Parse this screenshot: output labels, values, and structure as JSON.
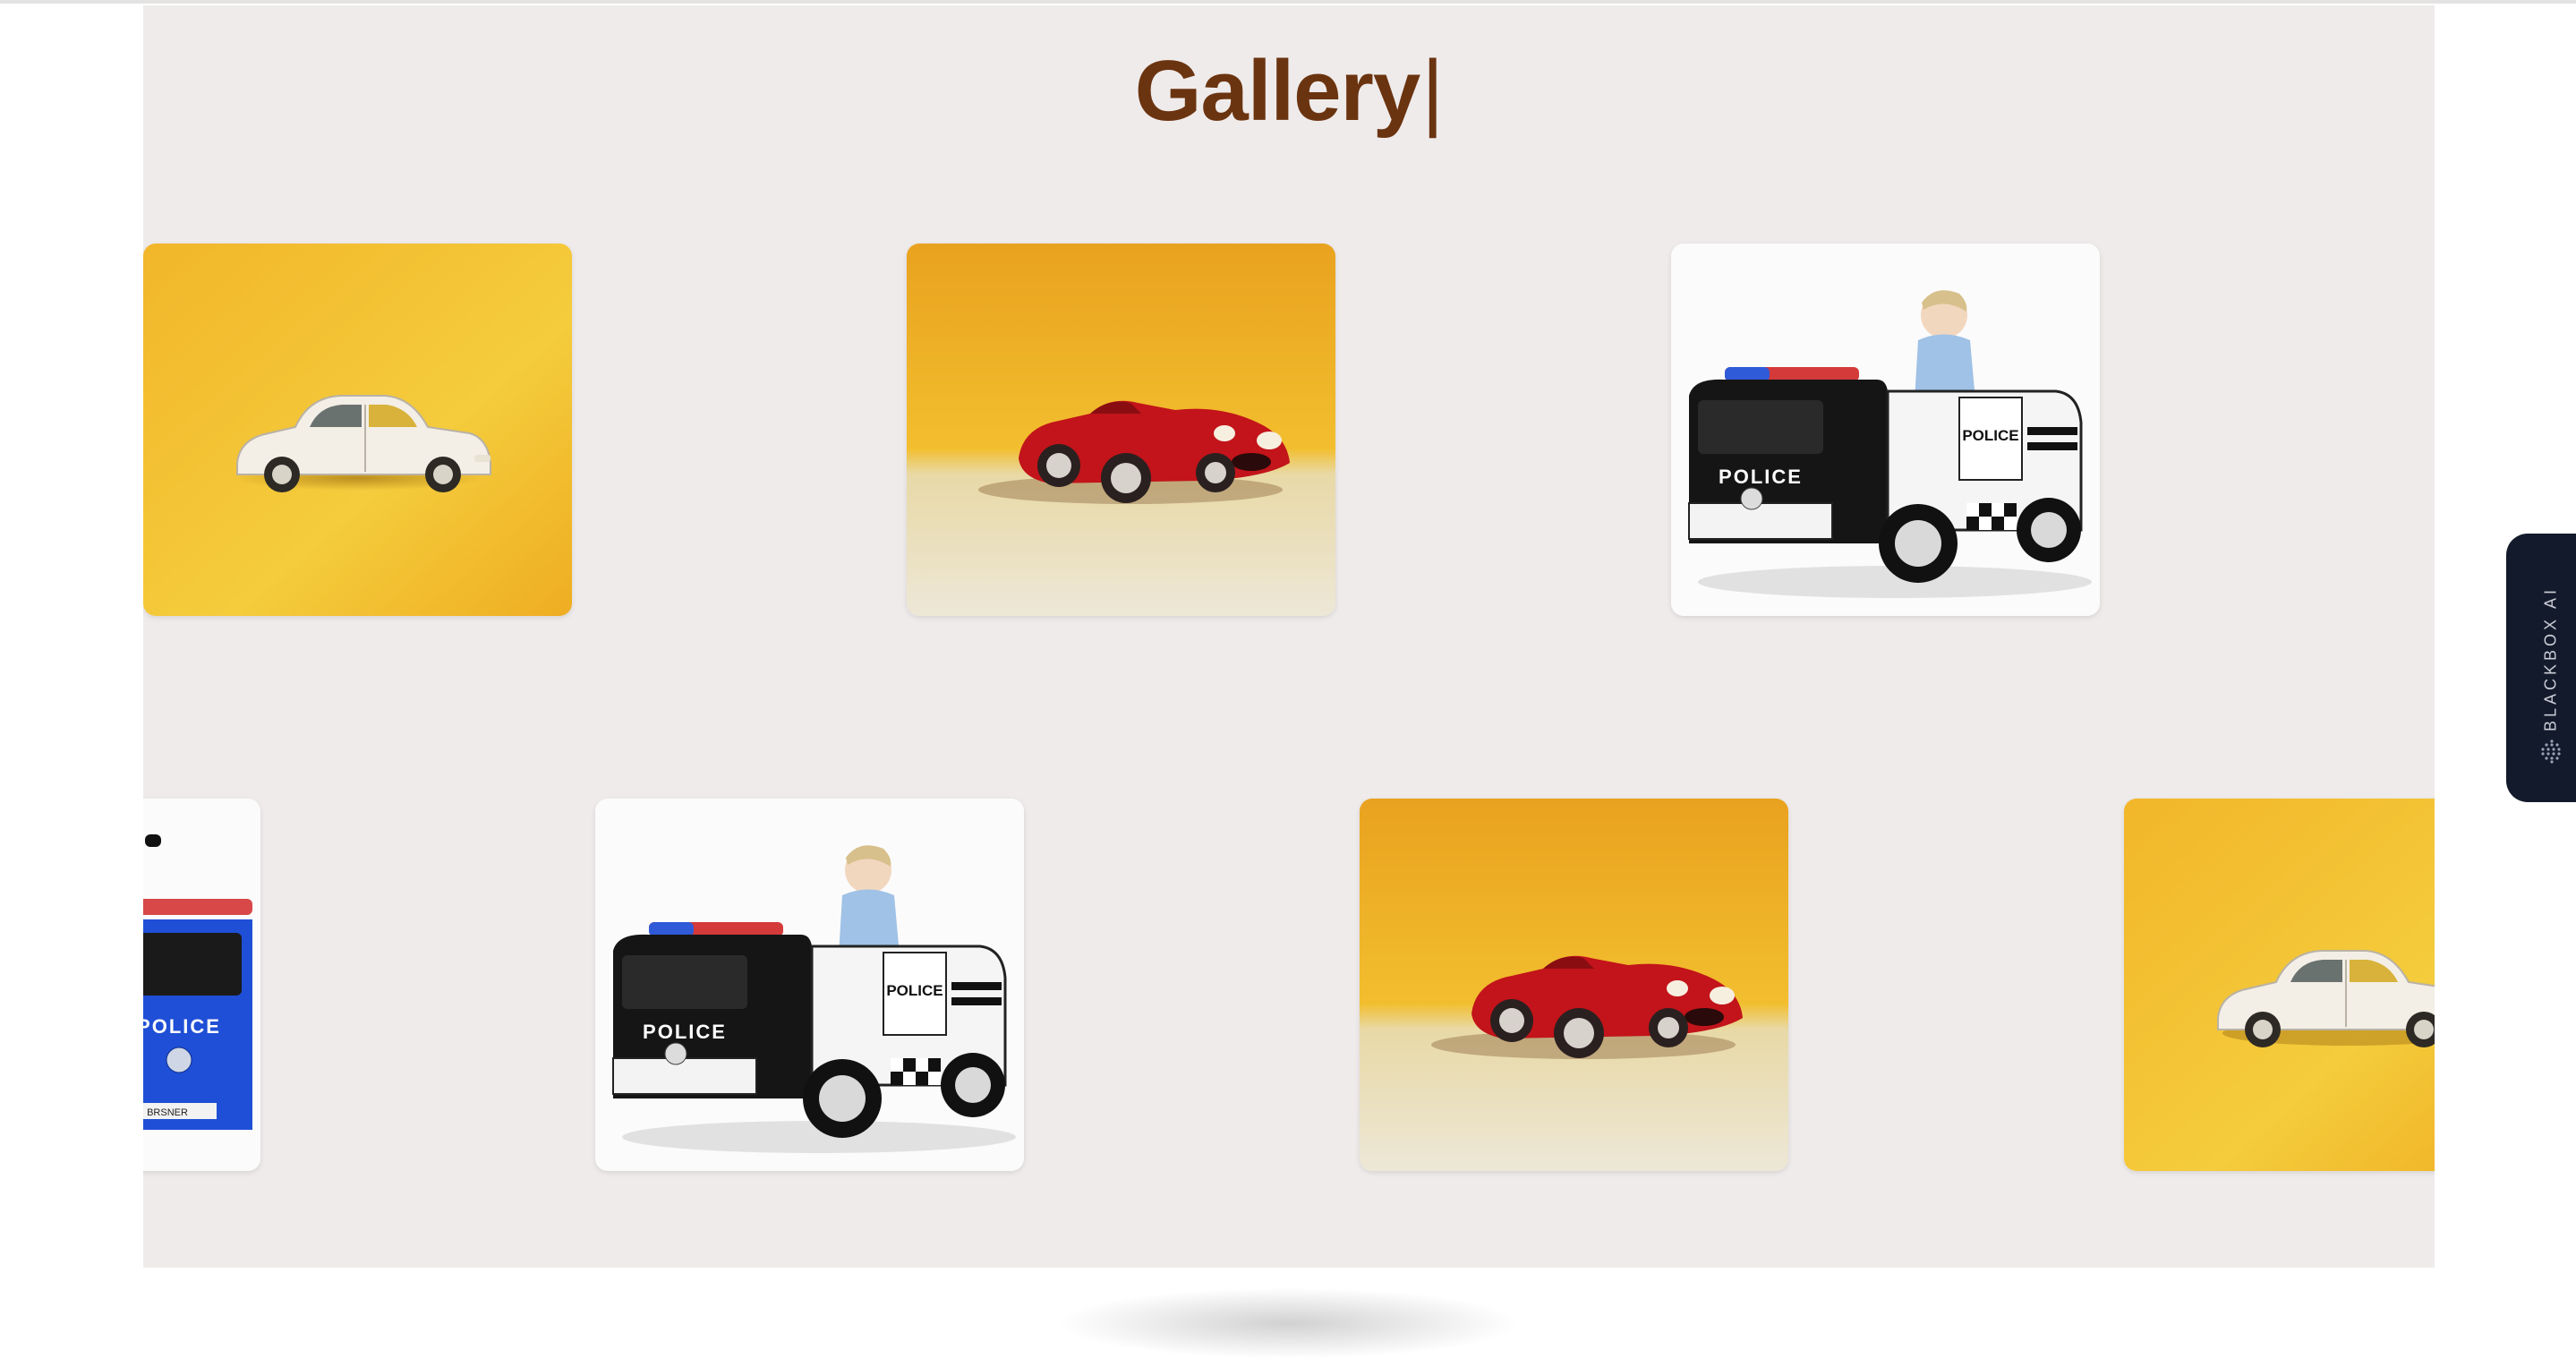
{
  "gallery": {
    "title": "Gallery",
    "cursor": "|",
    "row1": [
      {
        "image": "white-vintage-car",
        "alt": "White vintage toy car on yellow background"
      },
      {
        "image": "red-racing-car",
        "alt": "Red vintage racing toy car"
      },
      {
        "image": "police-truck-with-child",
        "alt": "Child riding black police ride-on truck"
      }
    ],
    "row2": [
      {
        "image": "blue-police-truck",
        "alt": "Blue police ride-on truck",
        "label": "POLICE"
      },
      {
        "image": "police-truck-with-child",
        "alt": "Child riding black police ride-on truck"
      },
      {
        "image": "red-racing-car",
        "alt": "Red vintage racing toy car"
      },
      {
        "image": "white-vintage-car",
        "alt": "White vintage toy car on yellow background"
      }
    ],
    "police_label": "POLICE"
  },
  "side_tab": {
    "label": "BLACKBOX AI",
    "icon": "blackbox-dots-icon"
  },
  "colors": {
    "title": "#6b3410",
    "section_bg": "#efebeb",
    "side_tab_bg": "#131a2b",
    "yellow": "#f2b72a"
  }
}
